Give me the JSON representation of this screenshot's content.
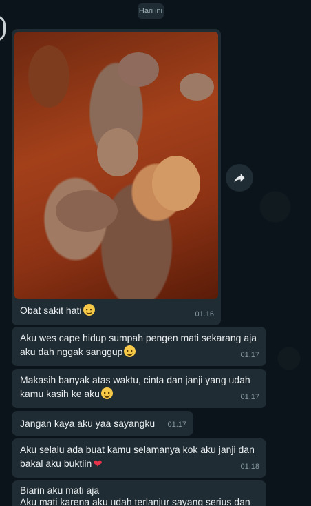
{
  "chat": {
    "date_label": "Hari ini",
    "photo_message": {
      "caption": "Obat sakit hati",
      "time": "01.16"
    },
    "messages": [
      {
        "text": "Aku wes cape hidup sumpah pengen mati sekarang aja aku dah nggak sanggup",
        "time": "01.17",
        "trailing": "smile-emoji"
      },
      {
        "text": "Makasih banyak atas waktu, cinta dan janji yang udah kamu kasih ke aku",
        "time": "01.17",
        "trailing": "smile-emoji"
      },
      {
        "text": "Jangan kaya aku yaa sayangku",
        "time": "01.17",
        "trailing": ""
      },
      {
        "text": "Aku selalu ada buat kamu selamanya kok aku janji dan bakal aku buktiin",
        "time": "01.18",
        "trailing": "red-heart-emoji"
      },
      {
        "text": "Biarin aku mati aja\nAku mati karena aku udah terlanjur sayang serius dan",
        "time": "",
        "trailing": ""
      }
    ]
  },
  "icons": {
    "forward": "share-forward-icon"
  },
  "colors": {
    "background": "#0b141a",
    "bubble": "#1f2c33",
    "text": "#e9edef",
    "timestamp": "#8696a0"
  }
}
